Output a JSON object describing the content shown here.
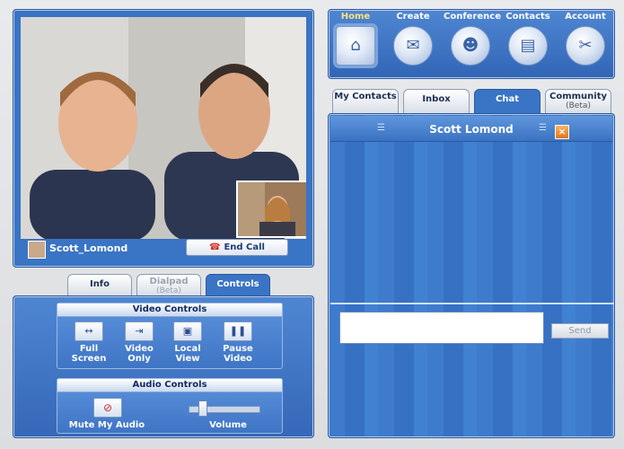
{
  "video": {
    "caller_name": "Scott_Lomond",
    "end_call_label": "End Call"
  },
  "nav": {
    "items": [
      {
        "label": "Home",
        "icon": "home-icon"
      },
      {
        "label": "Create",
        "icon": "create-icon"
      },
      {
        "label": "Conference",
        "icon": "conference-icon"
      },
      {
        "label": "Contacts",
        "icon": "contacts-icon"
      },
      {
        "label": "Account",
        "icon": "account-icon"
      }
    ],
    "active": "Home"
  },
  "right_tabs": [
    {
      "label": "My Contacts",
      "sub": ""
    },
    {
      "label": "Inbox",
      "sub": ""
    },
    {
      "label": "Chat",
      "sub": ""
    },
    {
      "label": "Community",
      "sub": "(Beta)"
    }
  ],
  "chat": {
    "title": "Scott Lomond",
    "input_value": "",
    "send_label": "Send"
  },
  "left_tabs": [
    {
      "label": "Info",
      "sub": ""
    },
    {
      "label": "Dialpad",
      "sub": "(Beta)"
    },
    {
      "label": "Controls",
      "sub": ""
    }
  ],
  "controls": {
    "video_title": "Video Controls",
    "video_buttons": [
      {
        "label1": "Full",
        "label2": "Screen"
      },
      {
        "label1": "Video",
        "label2": "Only"
      },
      {
        "label1": "Local",
        "label2": "View"
      },
      {
        "label1": "Pause",
        "label2": "Video"
      }
    ],
    "audio_title": "Audio Controls",
    "mute_label": "Mute My Audio",
    "volume_label": "Volume",
    "volume_level": 0.15
  },
  "colors": {
    "panel_blue": "#3a74c4",
    "active_nav_label": "#ffe27a",
    "end_call_icon": "#d02a1d"
  }
}
